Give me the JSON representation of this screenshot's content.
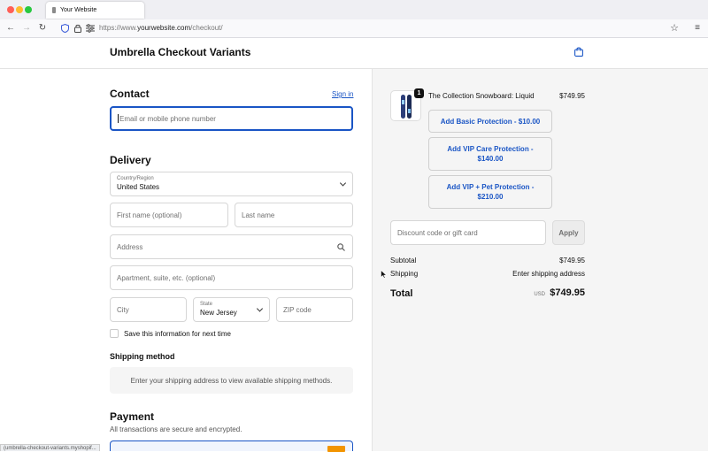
{
  "browser": {
    "tab_title": "Your Website",
    "url_prefix": "https://www.",
    "url_host": "yourwebsite.com",
    "url_path": "/checkout/",
    "status_text": "(umbrella-checkout-variants.myshopif..."
  },
  "header": {
    "store_title": "Umbrella Checkout Variants"
  },
  "contact": {
    "heading": "Contact",
    "sign_in": "Sign in",
    "email_placeholder": "Email or mobile phone number"
  },
  "delivery": {
    "heading": "Delivery",
    "country_label": "Country/Region",
    "country_value": "United States",
    "first_name_placeholder": "First name (optional)",
    "last_name_placeholder": "Last name",
    "address_placeholder": "Address",
    "apartment_placeholder": "Apartment, suite, etc. (optional)",
    "city_placeholder": "City",
    "state_label": "State",
    "state_value": "New Jersey",
    "zip_placeholder": "ZIP code",
    "save_info_label": "Save this information for next time"
  },
  "shipping_method": {
    "heading": "Shipping method",
    "message": "Enter your shipping address to view available shipping methods."
  },
  "payment": {
    "heading": "Payment",
    "subtext": "All transactions are secure and encrypted."
  },
  "order": {
    "product_name": "The Collection Snowboard: Liquid",
    "product_price": "$749.95",
    "quantity_badge": "1",
    "protection_buttons": [
      "Add Basic Protection - $10.00",
      "Add VIP Care Protection - $140.00",
      "Add VIP + Pet Protection - $210.00"
    ],
    "discount_placeholder": "Discount code or gift card",
    "apply_label": "Apply",
    "subtotal_label": "Subtotal",
    "subtotal_value": "$749.95",
    "shipping_label": "Shipping",
    "shipping_value": "Enter shipping address",
    "total_label": "Total",
    "total_currency": "USD",
    "total_value": "$749.95"
  },
  "colors": {
    "accent": "#1a55c5",
    "summary_bg": "#f5f5f5"
  }
}
